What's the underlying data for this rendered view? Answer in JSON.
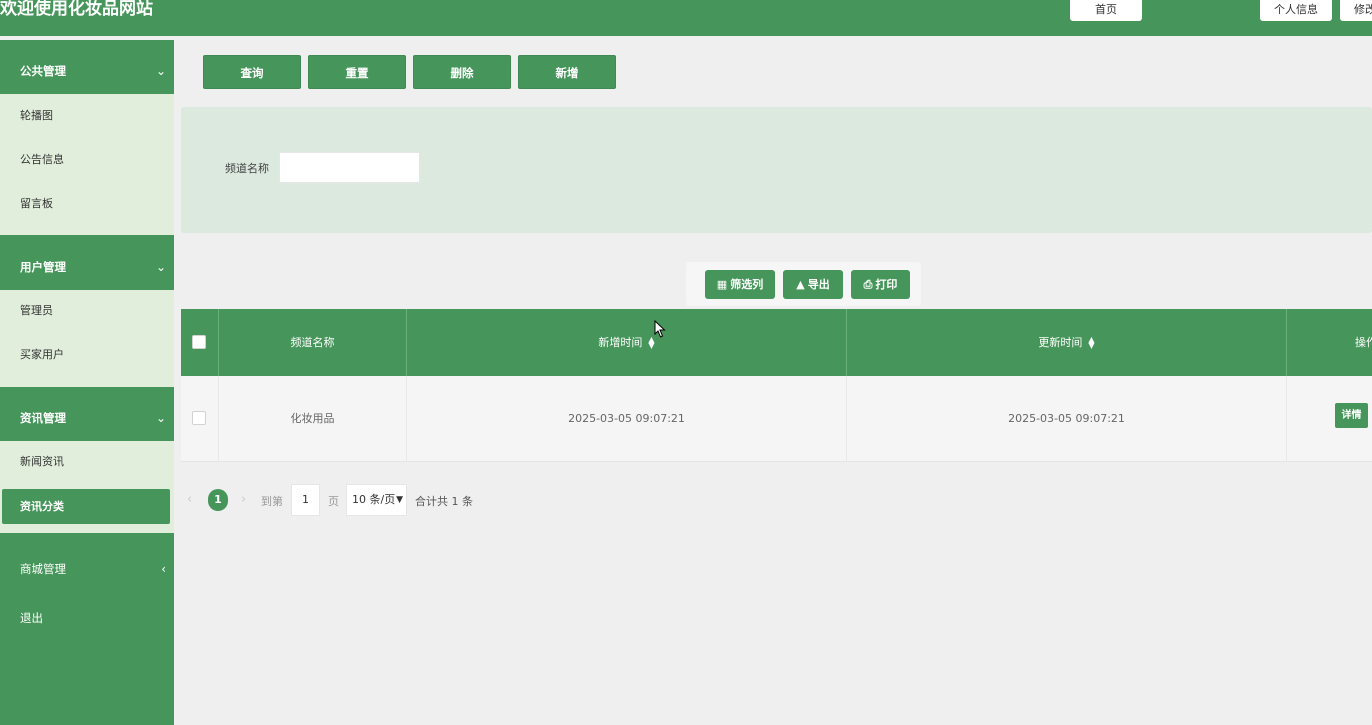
{
  "header": {
    "title": "欢迎使用化妆品网站",
    "home_label": "首页",
    "profile_label": "个人信息",
    "edit_label": "修改"
  },
  "sidebar": {
    "groups": [
      {
        "title": "公共管理",
        "items": [
          "轮播图",
          "公告信息",
          "留言板"
        ]
      },
      {
        "title": "用户管理",
        "items": [
          "管理员",
          "买家用户"
        ]
      },
      {
        "title": "资讯管理",
        "items": [
          "新闻资讯",
          "资讯分类"
        ]
      },
      {
        "title": "商城管理",
        "items": []
      }
    ],
    "active_item": "资讯分类",
    "logout_label": "退出"
  },
  "toolbar": {
    "query_label": "查询",
    "reset_label": "重置",
    "delete_label": "删除",
    "add_label": "新增"
  },
  "search": {
    "channel_label": "频道名称",
    "channel_value": ""
  },
  "actions": {
    "filter_label": "筛选列",
    "export_label": "导出",
    "print_label": "打印"
  },
  "table": {
    "columns": [
      "频道名称",
      "新增时间",
      "更新时间",
      "操作"
    ],
    "rows": [
      {
        "channel": "化妆用品",
        "created": "2025-03-05 09:07:21",
        "updated": "2025-03-05 09:07:21",
        "action": "详情"
      }
    ]
  },
  "pagination": {
    "current_page": "1",
    "goto_label": "到第",
    "goto_value": "1",
    "page_suffix": "页",
    "page_size": "10 条/页",
    "total": "合计共 1 条"
  },
  "colors": {
    "primary": "#46955a",
    "submenu_bg": "#e0eedb",
    "search_panel_bg": "#dce9df",
    "page_bg": "#efefef"
  }
}
